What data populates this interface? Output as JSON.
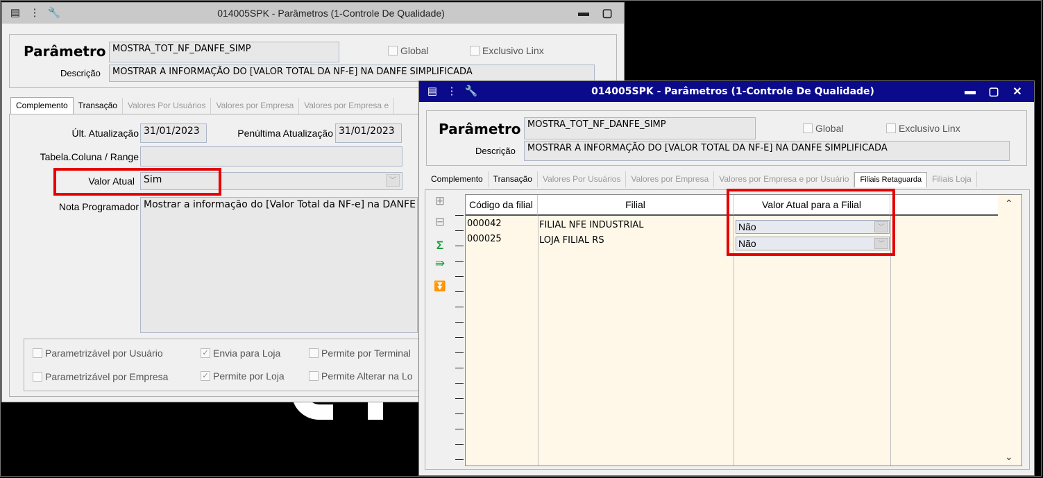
{
  "back_window": {
    "title": "014005SPK - Parâmetros (1-Controle De Qualidade)",
    "parametro_label": "Parâmetro",
    "parametro_value": "MOSTRA_TOT_NF_DANFE_SIMP",
    "global_label": "Global",
    "exclusivo_label": "Exclusivo Linx",
    "descricao_label": "Descrição",
    "descricao_value": "MOSTRAR A INFORMAÇÃO DO [VALOR TOTAL DA NF-E] NA DANFE SIMPLIFICADA",
    "tabs": [
      "Complemento",
      "Transação",
      "Valores Por Usuários",
      "Valores por Empresa",
      "Valores por Empresa e"
    ],
    "ult_atualizacao_label": "Últ. Atualização",
    "ult_atualizacao_value": "31/01/2023",
    "penultima_label": "Penúltima Atualização",
    "penultima_value": "31/01/2023",
    "tabela_label": "Tabela.Coluna / Range",
    "tabela_value": "",
    "valor_atual_label": "Valor Atual",
    "valor_atual_value": "Sim",
    "nota_label": "Nota Programador",
    "nota_value": "Mostrar a informação do [Valor Total da NF-e] na DANFE Sim",
    "checks": {
      "param_usuario": "Parametrizável por Usuário",
      "envia_loja": "Envia para Loja",
      "permite_terminal": "Permite por Terminal",
      "param_empresa": "Parametrizável por Empresa",
      "permite_loja": "Permite por Loja",
      "permite_alterar": "Permite Alterar na Lo"
    }
  },
  "front_window": {
    "title": "014005SPK - Parâmetros (1-Controle De Qualidade)",
    "parametro_label": "Parâmetro",
    "parametro_value": "MOSTRA_TOT_NF_DANFE_SIMP",
    "global_label": "Global",
    "exclusivo_label": "Exclusivo Linx",
    "descricao_label": "Descrição",
    "descricao_value": "MOSTRAR A INFORMAÇÃO DO [VALOR TOTAL DA NF-E] NA DANFE SIMPLIFICADA",
    "tabs": [
      "Complemento",
      "Transação",
      "Valores Por Usuários",
      "Valores por Empresa",
      "Valores por Empresa e por Usuário",
      "Filiais Retaguarda",
      "Filiais Loja"
    ],
    "grid": {
      "headers": [
        "Código da filial",
        "Filial",
        "Valor Atual para a Filial"
      ],
      "rows": [
        {
          "codigo": "000042",
          "filial": "FILIAL NFE INDUSTRIAL",
          "valor": "Não"
        },
        {
          "codigo": "000025",
          "filial": "LOJA FILIAL RS",
          "valor": "Não"
        }
      ]
    }
  }
}
